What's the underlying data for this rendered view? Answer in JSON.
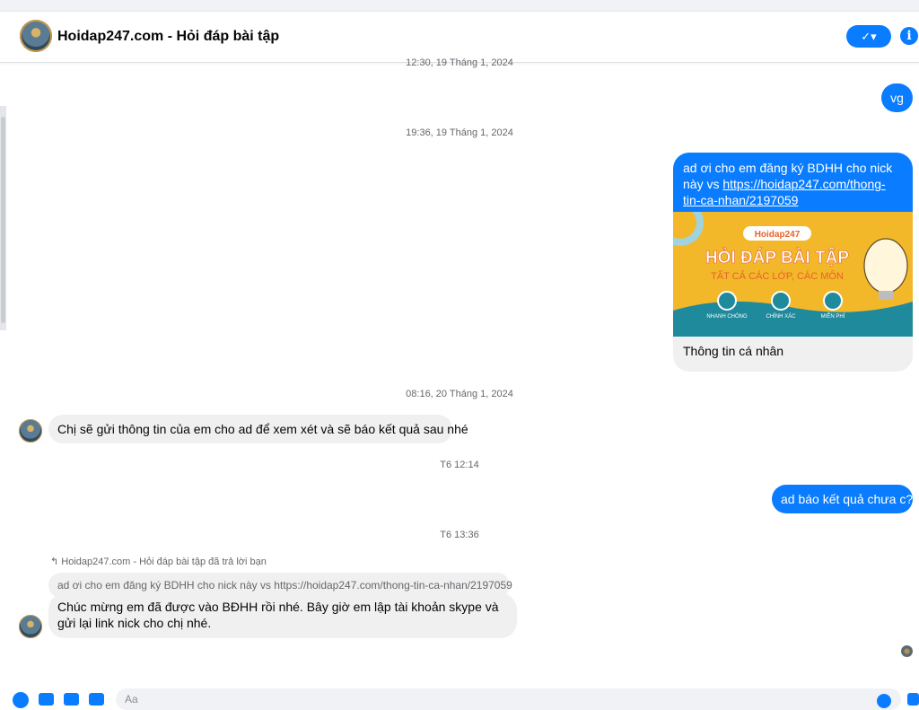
{
  "header": {
    "title": "Hoidap247.com - Hỏi đáp bài tập",
    "done_label": "✓▾",
    "info_label": "i"
  },
  "messages": {
    "ts1": "12:30, 19 Tháng 1, 2024",
    "out1": "vg",
    "ts2": "19:36, 19 Tháng 1, 2024",
    "card": {
      "text": "ad ơi cho em đăng ký BDHH cho nick này vs ",
      "link": "https://hoidap247.com/thong-tin-ca-nhan/2197059",
      "image_brand": "Hoidap247",
      "image_title": "HỎI ĐÁP BÀI TẬP",
      "image_subtitle": "TẤT CẢ CÁC LỚP, CÁC MÔN",
      "image_features": [
        "NHANH CHÓNG",
        "CHÍNH XÁC",
        "MIỄN PHÍ"
      ],
      "caption": "Thông tin cá nhân"
    },
    "ts3": "08:16, 20 Tháng 1, 2024",
    "in1": "Chị sẽ gửi thông tin của em cho ad để xem xét và sẽ báo kết quả sau nhé",
    "ts4": "T6 12:14",
    "out2": "ad báo kết quả chưa c?",
    "ts5": "T6 13:36",
    "reply_meta": "Hoidap247.com - Hỏi đáp bài tập đã trả lời bạn",
    "quoted": "ad ơi cho em đăng ký BDHH cho nick này  vs https://hoidap247.com/thong-tin-ca-nhan/2197059",
    "in2": "Chúc mừng em đã được vào BĐHH rồi nhé. Bây giờ em lập tài khoản skype và gửi lại link nick cho chị nhé."
  },
  "composer": {
    "placeholder": "Aa"
  },
  "colors": {
    "accent": "#0a7cff",
    "incoming_bg": "#f0f0f0",
    "card_yellow": "#f3b72a",
    "card_teal": "#1f8a9c"
  }
}
